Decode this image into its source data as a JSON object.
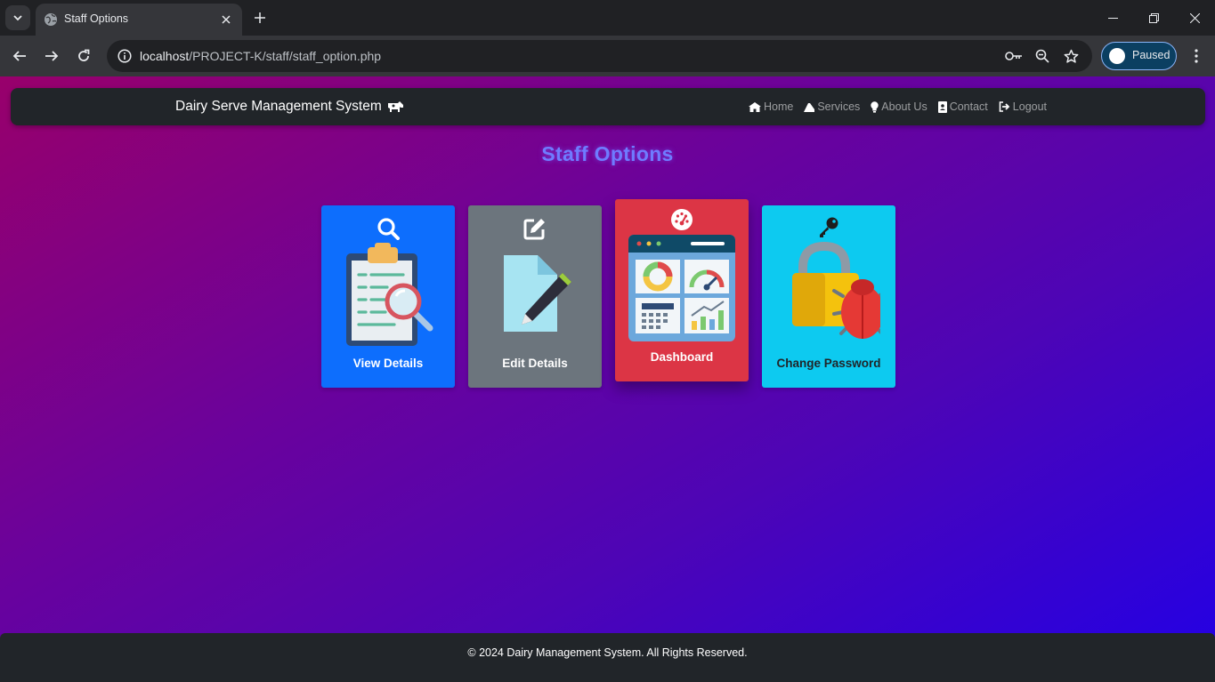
{
  "browser": {
    "tab_title": "Staff Options",
    "url_host": "localhost",
    "url_path": "/PROJECT-K/staff/staff_option.php",
    "profile_label": "Paused"
  },
  "navbar": {
    "brand": "Dairy Serve Management System",
    "links": [
      {
        "label": "Home",
        "icon": "home-icon"
      },
      {
        "label": "Services",
        "icon": "services-icon"
      },
      {
        "label": "About Us",
        "icon": "lightbulb-icon"
      },
      {
        "label": "Contact",
        "icon": "contact-icon"
      },
      {
        "label": "Logout",
        "icon": "logout-icon"
      }
    ]
  },
  "main": {
    "title": "Staff Options",
    "cards": [
      {
        "label": "View Details",
        "color": "#0d6efd",
        "icon": "search-icon"
      },
      {
        "label": "Edit Details",
        "color": "#6c757d",
        "icon": "edit-icon"
      },
      {
        "label": "Dashboard",
        "color": "#dc3545",
        "icon": "tachometer-icon"
      },
      {
        "label": "Change Password",
        "color": "#0dcaf0",
        "icon": "key-icon"
      }
    ]
  },
  "footer": {
    "text": "© 2024 Dairy Management System. All Rights Reserved."
  }
}
